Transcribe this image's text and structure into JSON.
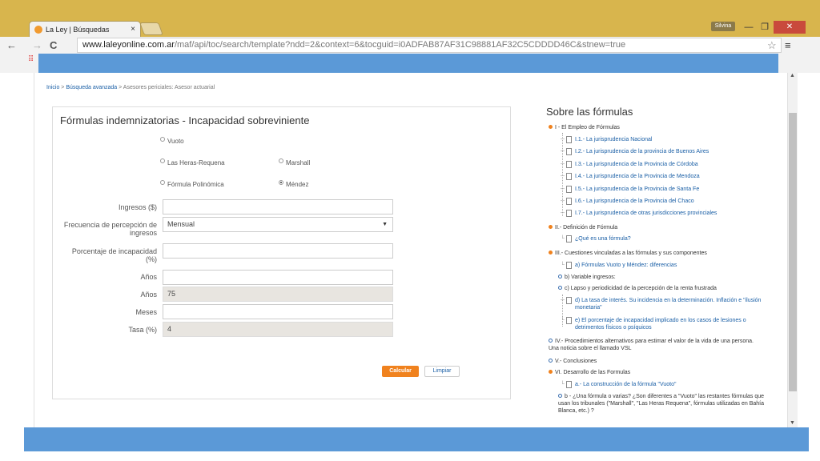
{
  "browser": {
    "tab_title": "La Ley | Búsquedas",
    "tab_close": "×",
    "user": "Silvina",
    "url_domain": "www.laleyonline.com.ar",
    "url_path": "/maf/api/toc/search/template?ndd=2&context=6&tocguid=i0ADFAB87AF31C98881AF32C5CDDDD46C&stnew=true",
    "nav_back": "←",
    "nav_forward": "→",
    "nav_reload": "C",
    "star": "☆",
    "menu": "≡",
    "minimize": "—",
    "maximize": "❐",
    "close": "✕",
    "apps": "⠿"
  },
  "breadcrumb": {
    "home": "Inicio",
    "sep1": ">",
    "advanced": "Búsqueda avanzada",
    "rest": "> Asesores periciales: Asesor actuarial"
  },
  "form": {
    "title": "Fórmulas indemnizatorias - Incapacidad sobreviniente",
    "radios": [
      {
        "label": "Vuoto",
        "checked": false
      },
      {
        "label": "Las Heras-Requena",
        "checked": false
      },
      {
        "label": "Marshall",
        "checked": false
      },
      {
        "label": "Fórmula Polinómica",
        "checked": false
      },
      {
        "label": "Méndez",
        "checked": true
      }
    ],
    "fields": [
      {
        "label": "Ingresos ($)",
        "value": ""
      },
      {
        "label": "Frecuencia de percepción de ingresos",
        "value": "Mensual"
      },
      {
        "label": "Porcentaje de incapacidad (%)",
        "value": ""
      },
      {
        "label": "Años",
        "value": ""
      },
      {
        "label": "Años",
        "value": "75"
      },
      {
        "label": "Meses",
        "value": ""
      },
      {
        "label": "Tasa (%)",
        "value": "4"
      }
    ],
    "select_caret": "▼",
    "calc_button": "Calcular",
    "clear_button": "Limpiar"
  },
  "sidebar": {
    "title": "Sobre las fórmulas",
    "sections": [
      {
        "label": "I - El Empleo de Fórmulas",
        "bullet": "orange"
      },
      {
        "label": "II.- Definición de Fórmula",
        "bullet": "orange"
      },
      {
        "label": "III.- Cuestiones vinculadas a las fórmulas y sus componentes",
        "bullet": "orange"
      },
      {
        "label": "b) Variable ingresos:",
        "bullet": "blue"
      },
      {
        "label": "c) Lapso y periodicidad de la percepción de la renta frustrada",
        "bullet": "blue"
      },
      {
        "label": "IV.- Procedimientos alternativos para estimar el valor de la vida de una persona. Una noticia sobre el llamado VSL",
        "bullet": "blue"
      },
      {
        "label": "V.- Conclusiones",
        "bullet": "blue"
      },
      {
        "label": "VI. Desarrollo de las Formulas",
        "bullet": "orange"
      },
      {
        "label": "b - ¿Una fórmula o varias? ¿Son diferentes a \"Vuoto\" las restantes fórmulas que usan los tribunales (\"Marshall\", \"Las Heras Requena\", fórmulas utilizadas en Bahía Blanca, etc.) ?",
        "bullet": "blue"
      }
    ],
    "items": [
      {
        "label": "I.1.- La jurisprudencia Nacional"
      },
      {
        "label": "I.2.- La jurisprudencia de la provincia de Buenos Aires"
      },
      {
        "label": "I.3.- La jurisprudencia de la Provincia de Córdoba"
      },
      {
        "label": "I.4.- La jurisprudencia de la Provincia de Mendoza"
      },
      {
        "label": "I.5.- La jurisprudencia de la Provincia de Santa Fe"
      },
      {
        "label": "I.6.- La jurisprudencia de la Provincia del Chaco"
      },
      {
        "label": "I.7.- La jurisprudencia de otras jurisdicciones provinciales"
      },
      {
        "label": "¿Qué es una fórmula?"
      },
      {
        "label": "a) Fórmulas Vuoto y Méndez: diferencias"
      },
      {
        "label": "d) La tasa de interés. Su incidencia en la determinación. Inflación e \"ilusión monetaria\""
      },
      {
        "label": "e) El porcentaje de incapacidad implicado en los casos de lesiones o detrimentos físicos o psíquicos"
      },
      {
        "label": "a.- La construcción de la fórmula \"Vuoto\""
      }
    ]
  },
  "colors": {
    "accent_blue": "#5b99d7",
    "link": "#1a5fa6",
    "orange": "#f0821e"
  }
}
